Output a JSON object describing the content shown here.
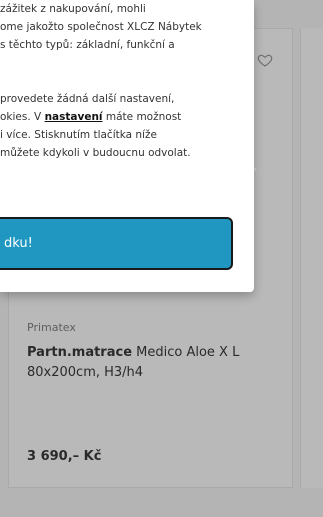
{
  "cookie_modal": {
    "paragraph1_lines": [
      " zážitek z nakupování, mohli",
      "ome jakožto společnost XLCZ Nábytek",
      "s těchto typů: základní, funkční a"
    ],
    "paragraph2": {
      "line1": "provedete žádná další nastavení,",
      "line2_before": "okies. V ",
      "line2_link": "nastavení",
      "line2_after": " máte možnost",
      "line3": "i více. Stisknutím tlačítka níže",
      "line4": " můžete kdykoli v budoucnu odvolat."
    },
    "accept_button_label": "dku!"
  },
  "product": {
    "brand": "Primatex",
    "title_bold": "Partn.matrace",
    "title_rest": " Medico Aloe X L 80x200cm, H3/h4",
    "price": "3 690,– Kč"
  },
  "icons": {
    "wishlist": "heart-icon"
  }
}
